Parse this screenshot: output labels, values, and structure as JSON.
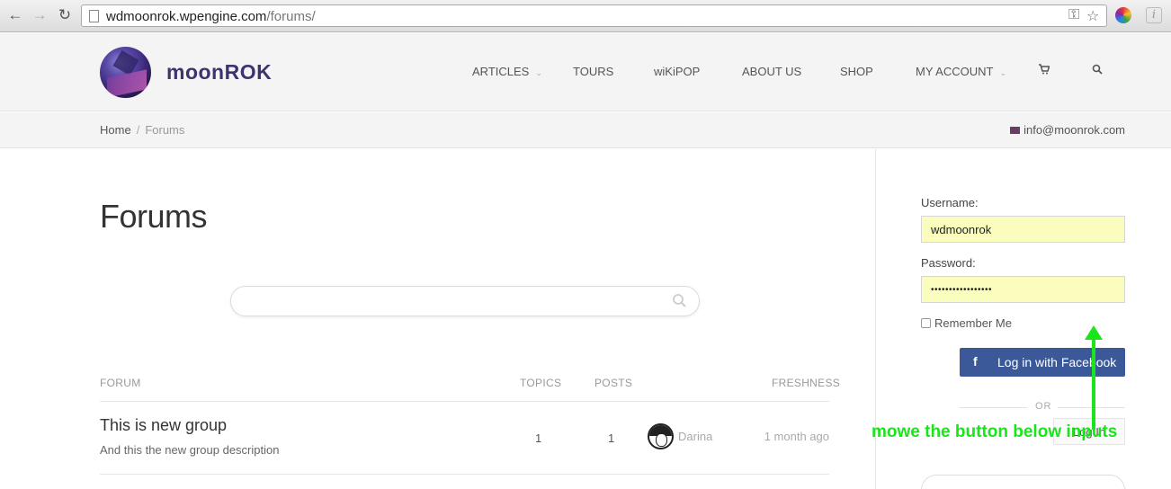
{
  "browser": {
    "url_host": "wdmoonrok.wpengine.com",
    "url_path": "/forums/"
  },
  "site": {
    "logo_text": "moonROK",
    "menu": [
      {
        "label": "ARTICLES",
        "dropdown": true
      },
      {
        "label": "TOURS",
        "dropdown": false
      },
      {
        "label": "wiKiPOP",
        "dropdown": false
      },
      {
        "label": "ABOUT US",
        "dropdown": false
      },
      {
        "label": "SHOP",
        "dropdown": false
      },
      {
        "label": "MY ACCOUNT",
        "dropdown": true
      }
    ],
    "cart_icon": "cart-icon",
    "search_icon": "search-icon"
  },
  "breadcrumb": {
    "home": "Home",
    "separator": "/",
    "current": "Forums"
  },
  "contact_email": "info@moonrok.com",
  "page": {
    "title": "Forums",
    "search_placeholder": ""
  },
  "table": {
    "headers": {
      "forum": "FORUM",
      "topics": "TOPICS",
      "posts": "POSTS",
      "freshness": "FRESHNESS"
    },
    "rows": [
      {
        "name": "This is new group",
        "description": "And this the new group description",
        "topics": "1",
        "posts": "1",
        "freshness_user": "Darina",
        "freshness_time": "1 month ago"
      }
    ]
  },
  "login": {
    "username_label": "Username:",
    "username_value": "wdmoonrok",
    "password_label": "Password:",
    "password_value": "•••••••••••••••••",
    "remember_label": "Remember Me",
    "facebook_button": "Log in with Facebook",
    "or_text": "OR",
    "login_button": "Log In"
  },
  "annotation": {
    "text": "mowe the button below inputs",
    "color": "#1ae51a"
  },
  "colors": {
    "brand": "#3b3470",
    "facebook": "#3b5999",
    "autofill": "#fafdbe"
  }
}
